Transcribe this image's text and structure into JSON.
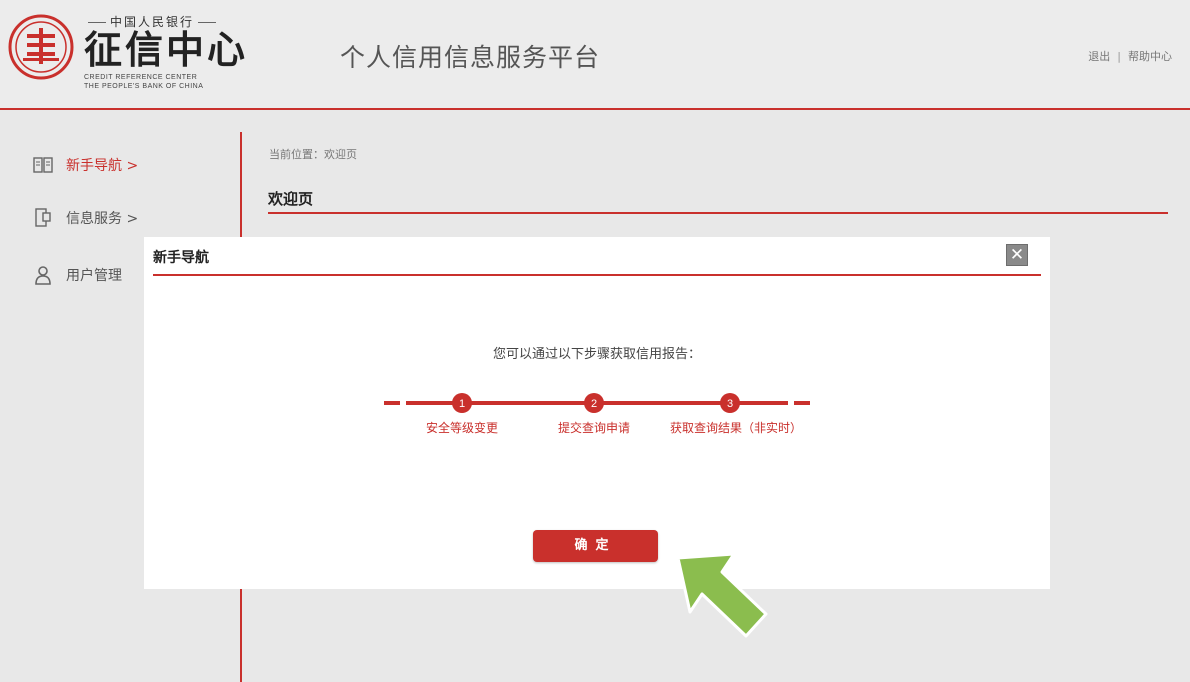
{
  "header": {
    "logo_top": "中国人民银行",
    "logo_main": "征信中心",
    "logo_en_line1": "CREDIT REFERENCE CENTER",
    "logo_en_line2": "THE PEOPLE'S BANK OF CHINA",
    "platform_title": "个人信用信息服务平台",
    "logout_label": "退出",
    "separator": "|",
    "help_label": "帮助中心"
  },
  "sidebar": {
    "items": [
      {
        "label": "新手导航 >",
        "icon": "book-icon",
        "active": true
      },
      {
        "label": "信息服务 >",
        "icon": "document-icon",
        "active": false
      },
      {
        "label": "用户管理",
        "icon": "user-icon",
        "active": false
      }
    ]
  },
  "content": {
    "breadcrumb": "当前位置：欢迎页",
    "title": "欢迎页"
  },
  "modal": {
    "title": "新手导航",
    "close_glyph": "✕",
    "intro": "您可以通过以下步骤获取信用报告：",
    "steps": [
      {
        "number": "1",
        "label": "安全等级变更"
      },
      {
        "number": "2",
        "label": "提交查询申请"
      },
      {
        "number": "3",
        "label": "获取查询结果（非实时）"
      }
    ],
    "confirm_label": "确定"
  },
  "colors": {
    "accent": "#c9302c",
    "pointer_arrow": "#8bbd4e"
  }
}
